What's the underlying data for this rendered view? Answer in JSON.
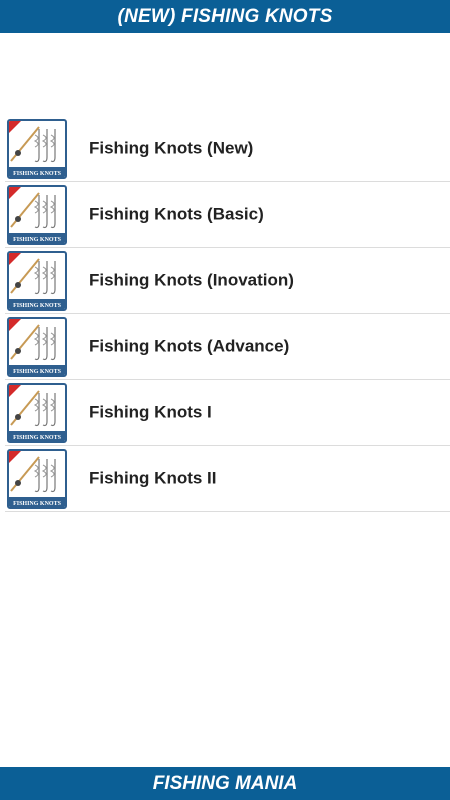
{
  "header": {
    "title": "(NEW) FISHING KNOTS"
  },
  "list": {
    "items": [
      {
        "label": "Fishing Knots (New)",
        "icon": "fishing-knots-app-icon",
        "icon_text": "FISHING KNOTS"
      },
      {
        "label": "Fishing Knots (Basic)",
        "icon": "fishing-knots-app-icon",
        "icon_text": "FISHING KNOTS"
      },
      {
        "label": "Fishing Knots (Inovation)",
        "icon": "fishing-knots-app-icon",
        "icon_text": "FISHING KNOTS"
      },
      {
        "label": "Fishing Knots (Advance)",
        "icon": "fishing-knots-app-icon",
        "icon_text": "FISHING KNOTS"
      },
      {
        "label": "Fishing Knots I",
        "icon": "fishing-knots-app-icon",
        "icon_text": "FISHING KNOTS"
      },
      {
        "label": "Fishing Knots II",
        "icon": "fishing-knots-app-icon",
        "icon_text": "FISHING KNOTS"
      }
    ]
  },
  "footer": {
    "title": "FISHING MANIA"
  },
  "colors": {
    "bar": "#0b5f96",
    "text": "#222222",
    "divider": "#dcdcdc"
  }
}
